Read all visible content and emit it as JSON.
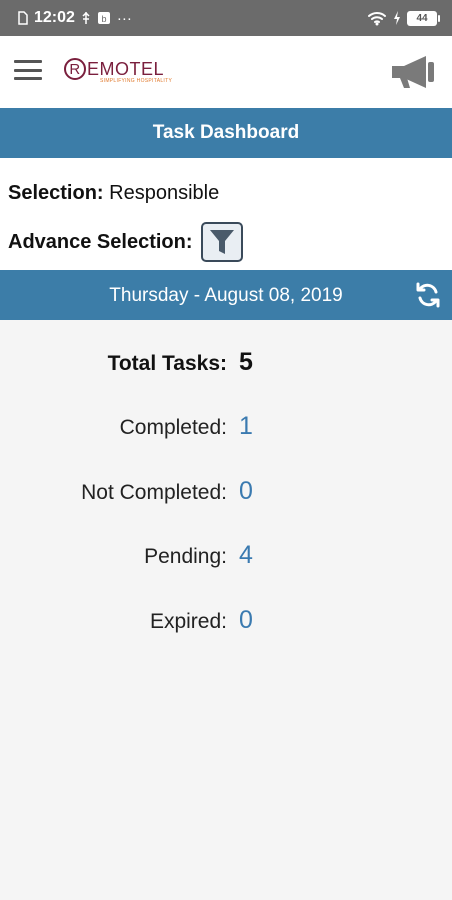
{
  "status_bar": {
    "time": "12:02",
    "extra_icons": "··· ",
    "battery": "44"
  },
  "app_bar": {
    "logo_text": "EMOTEL",
    "logo_letter": "R",
    "logo_tagline": "SIMPLIFYING HOSPITALITY"
  },
  "title_bar": {
    "title": "Task Dashboard"
  },
  "selection": {
    "label": "Selection:",
    "value": "Responsible",
    "advance_label": "Advance Selection:"
  },
  "date_bar": {
    "date": "Thursday - August 08, 2019"
  },
  "stats": {
    "total": {
      "label": "Total Tasks:",
      "value": "5"
    },
    "completed": {
      "label": "Completed:",
      "value": "1"
    },
    "not_completed": {
      "label": "Not Completed:",
      "value": "0"
    },
    "pending": {
      "label": "Pending:",
      "value": "4"
    },
    "expired": {
      "label": "Expired:",
      "value": "0"
    }
  },
  "colors": {
    "primary_blue": "#3c7da8",
    "value_blue": "#3a7ab0",
    "logo_maroon": "#7a1f3d",
    "status_bar_gray": "#6b6b6b"
  }
}
